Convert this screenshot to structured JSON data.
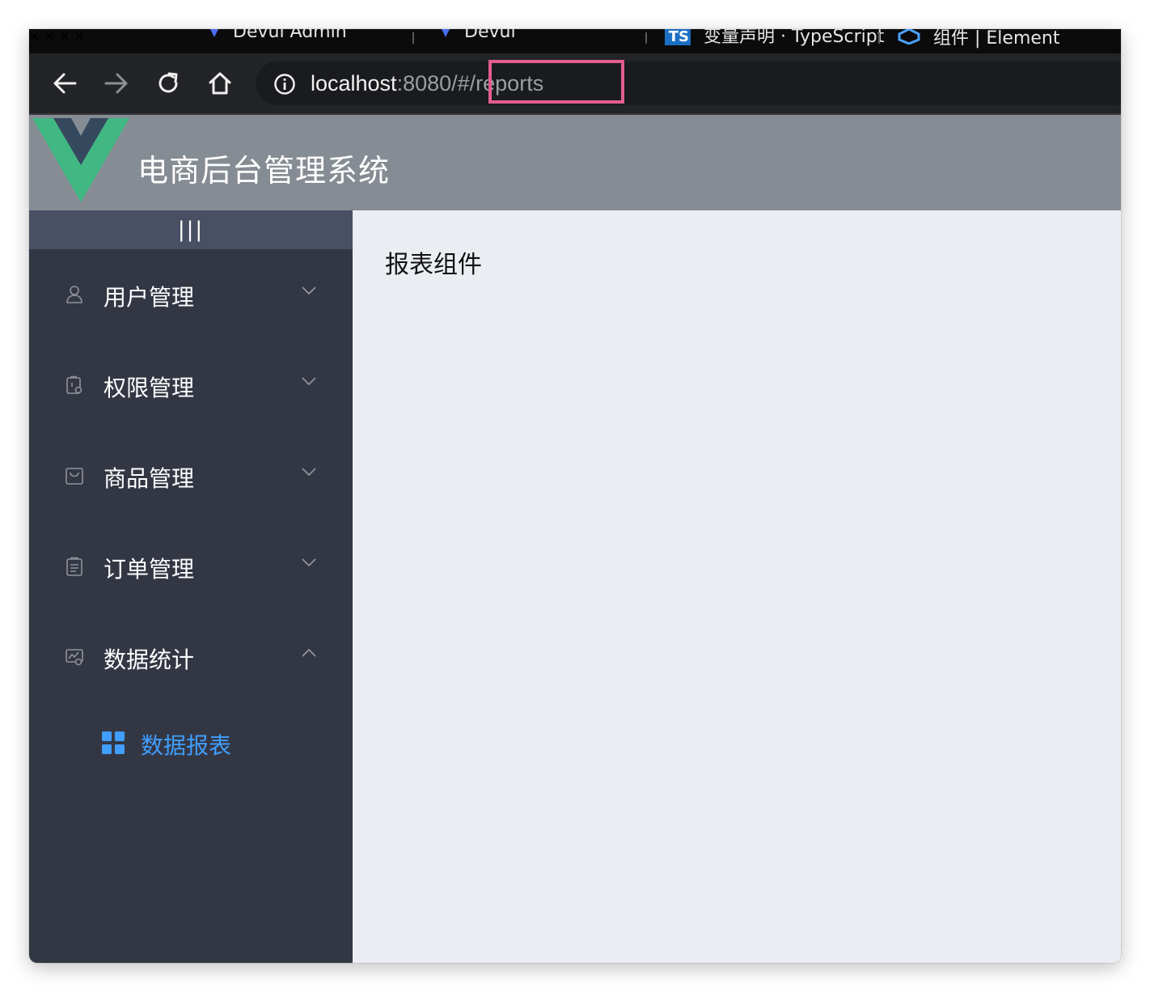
{
  "browser": {
    "tabs": [
      {
        "title": "Devui Admin"
      },
      {
        "title": "Devui"
      },
      {
        "title": "变量声明 · TypeScript"
      },
      {
        "title": "组件 | Element"
      }
    ],
    "url_host": "localhost",
    "url_rest": ":8080/#/reports"
  },
  "app": {
    "title": "电商后台管理系统"
  },
  "sidebar": {
    "toggle_label": "|||",
    "menus": [
      {
        "label": "用户管理",
        "icon": "user-icon",
        "expanded": false
      },
      {
        "label": "权限管理",
        "icon": "lock-icon",
        "expanded": false
      },
      {
        "label": "商品管理",
        "icon": "goods-icon",
        "expanded": false
      },
      {
        "label": "订单管理",
        "icon": "order-icon",
        "expanded": false
      },
      {
        "label": "数据统计",
        "icon": "data-analysis-icon",
        "expanded": true
      }
    ],
    "submenu": {
      "label": "数据报表",
      "icon": "menu-grid-icon",
      "active": true
    }
  },
  "main": {
    "heading": "报表组件"
  },
  "colors": {
    "sidebar_bg": "#333744",
    "header_bg": "#868c93",
    "active_text": "#409eff",
    "highlight_box": "#e35d8f"
  }
}
